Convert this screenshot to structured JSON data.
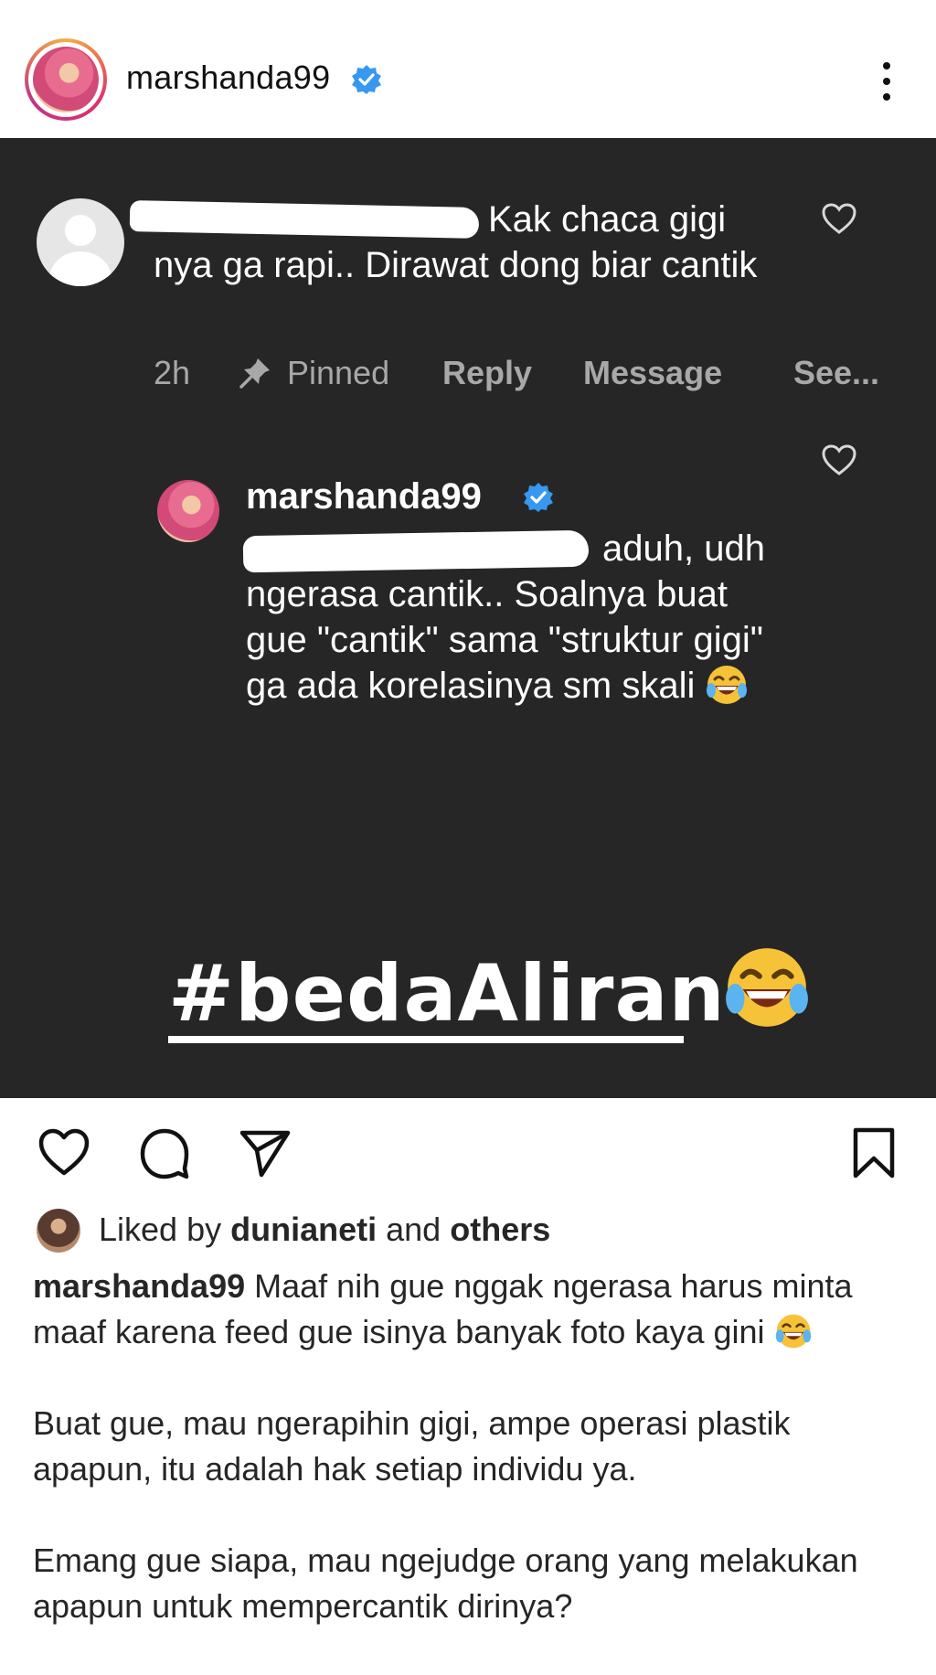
{
  "header": {
    "username": "marshanda99"
  },
  "post_image": {
    "comment": {
      "text": "Kak chaca gigi nya ga rapi.. Dirawat dong biar cantik",
      "time": "2h",
      "pinned_label": "Pinned",
      "reply_label": "Reply",
      "message_label": "Message",
      "see_label": "See..."
    },
    "reply": {
      "username": "marshanda99",
      "text": "aduh, udh ngerasa cantik.. Soalnya buat gue \"cantik\" sama \"struktur gigi\" ga ada korelasinya sm skali"
    },
    "hashtag": "#bedaAliran"
  },
  "likes": {
    "prefix": "Liked by",
    "user": "dunianeti",
    "and": "and",
    "others": "others"
  },
  "caption": {
    "username": "marshanda99",
    "p1": "Maaf nih gue nggak ngerasa harus minta maaf karena feed gue isinya banyak foto kaya gini",
    "p2": "Buat gue, mau ngerapihin gigi, ampe operasi plastik apapun, itu adalah hak setiap individu ya.",
    "p3": "Emang gue siapa, mau ngejudge orang yang melakukan apapun untuk mempercantik dirinya?"
  },
  "colors": {
    "verified": "#3897f0",
    "image_bg": "#262626",
    "meta_gray": "#a8a8a8"
  },
  "icons": [
    "verified-icon",
    "more-icon",
    "pin-icon",
    "heart-icon",
    "comment-icon",
    "share-icon",
    "bookmark-icon",
    "laughing-emoji-icon"
  ]
}
